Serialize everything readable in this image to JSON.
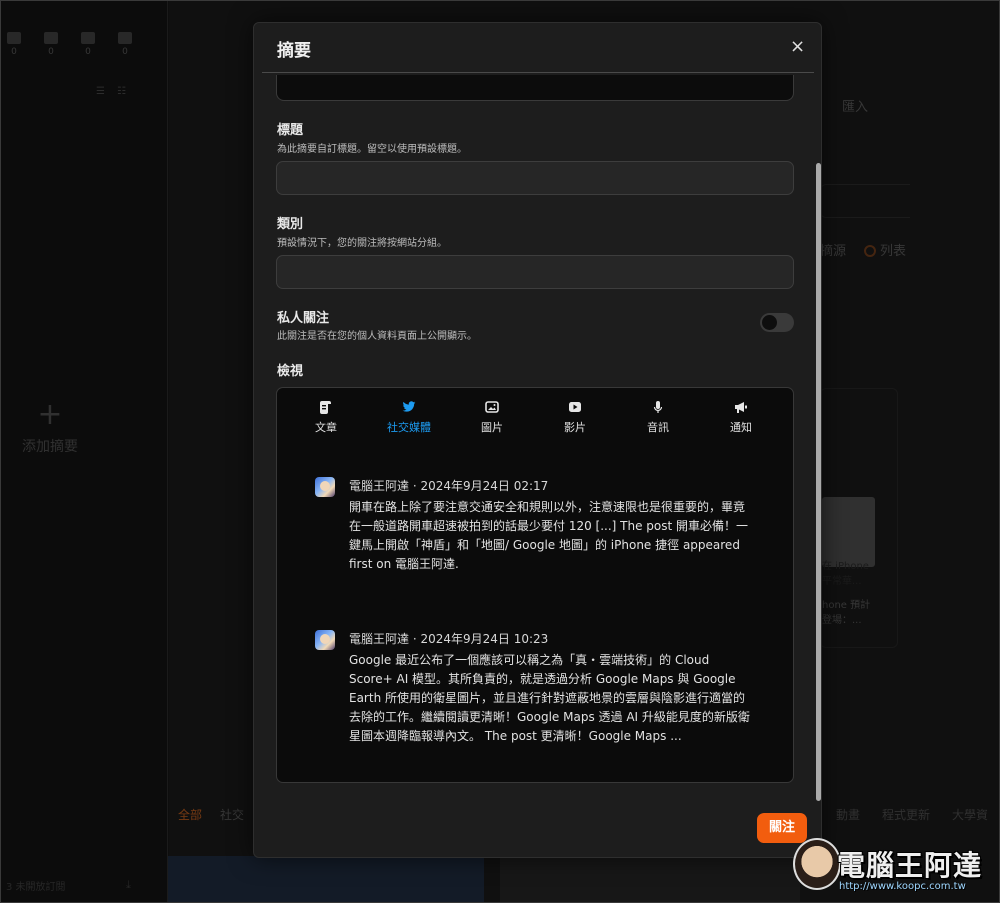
{
  "background": {
    "stats": [
      "0",
      "0",
      "0",
      "0"
    ],
    "add_summary_label": "添加摘要",
    "bottom_tabs": [
      "全部",
      "社交"
    ],
    "bottom_tabs_right": [
      "動畫",
      "程式更新",
      "大學資"
    ],
    "right_texts": [
      "匯入",
      "摘源",
      "列表"
    ],
    "card_thumb_text": "在 iPhone 平常華...",
    "card_text_lines": [
      "hone 預計",
      "登場：..."
    ],
    "bottom_left_text": "3 未開放訂閱"
  },
  "modal": {
    "title": "摘要",
    "close_symbol": "×",
    "fields": {
      "title": {
        "label": "標題",
        "help": "為此摘要自訂標題。留空以使用預設標題。",
        "value": ""
      },
      "category": {
        "label": "類別",
        "help": "預設情況下，您的關注將按網站分組。",
        "value": ""
      },
      "private": {
        "label": "私人關注",
        "help": "此關注是否在您的個人資料頁面上公開顯示。",
        "enabled": false
      }
    },
    "preview": {
      "label": "檢視",
      "tabs": [
        {
          "label": "文章",
          "icon": "article-icon"
        },
        {
          "label": "社交媒體",
          "icon": "twitter-icon"
        },
        {
          "label": "圖片",
          "icon": "image-icon"
        },
        {
          "label": "影片",
          "icon": "video-icon"
        },
        {
          "label": "音訊",
          "icon": "microphone-icon"
        },
        {
          "label": "通知",
          "icon": "megaphone-icon"
        }
      ],
      "active_tab": "社交媒體",
      "posts": [
        {
          "author": "電腦王阿達",
          "date": "2024年9月24日 02:17",
          "body": "開車在路上除了要注意交通安全和規則以外，注意速限也是很重要的，畢竟在一般道路開車超速被拍到的話最少要付 120 [...] The post 開車必備！一鍵馬上開啟「神盾」和「地圖/ Google 地圖」的 iPhone 捷徑 appeared first on 電腦王阿達."
        },
        {
          "author": "電腦王阿達",
          "date": "2024年9月24日 10:23",
          "body": "Google 最近公布了一個應該可以稱之為「真・雲端技術」的 Cloud Score+ AI 模型。其所負責的，就是透過分析 Google Maps 與 Google Earth 所使用的衛星圖片，並且進行針對遮蔽地景的雲層與陰影進行適當的去除的工作。繼續閱讀更清晰！Google Maps 透過 AI 升級能見度的新版衛星圖本週降臨報導內文。 The post 更清晰！Google Maps ..."
        }
      ]
    },
    "follow_button": "關注"
  },
  "watermark": {
    "text": "電腦王阿達",
    "url": "http://www.koopc.com.tw"
  },
  "colors": {
    "accent": "#f25d0e",
    "twitter_blue": "#1d9bf0",
    "modal_bg": "#1d1d1d"
  }
}
